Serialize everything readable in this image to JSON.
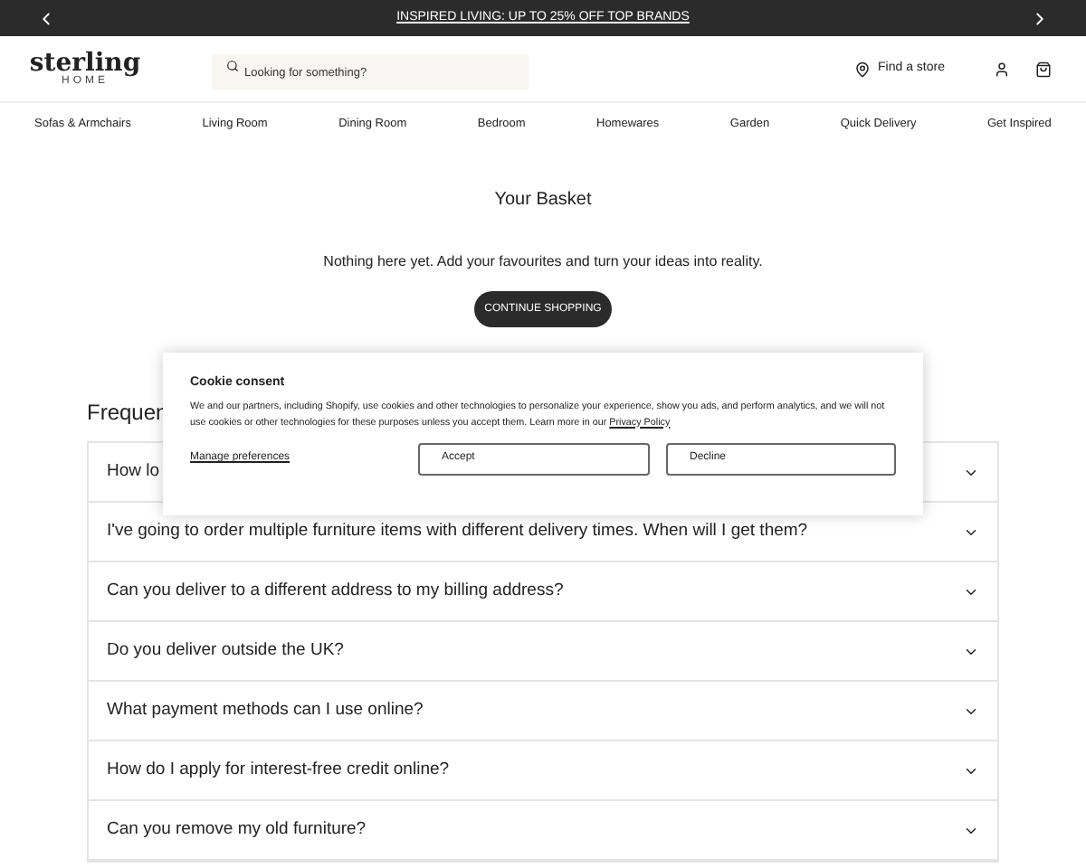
{
  "promo_bar": {
    "text": "INSPIRED LIVING: UP TO 25% OFF TOP BRANDS"
  },
  "header": {
    "logo": "sterling",
    "logo_sub": "HOME",
    "search": {
      "placeholder": "Looking for something?"
    },
    "find_store": "Find a store"
  },
  "nav": [
    "Sofas & Armchairs",
    "Living Room",
    "Dining Room",
    "Bedroom",
    "Homewares",
    "Garden",
    "Quick Delivery",
    "Get Inspired"
  ],
  "basket": {
    "title": "Your Basket",
    "message": "Nothing here yet. Add your favourites and turn your ideas into reality.",
    "button": "CONTINUE SHOPPING"
  },
  "faq": {
    "heading": "Frequen",
    "items": [
      {
        "question": "How lo",
        "expanded": false
      },
      {
        "question": "I've going to order multiple furniture items with different delivery times. When will I get them?",
        "expanded": false
      },
      {
        "question": "Can you deliver to a different address to my billing address?",
        "expanded": false
      },
      {
        "question": "Do you deliver outside the UK?",
        "expanded": false
      },
      {
        "question": "What payment methods can I use online?",
        "expanded": false
      },
      {
        "question": "How do I apply for interest-free credit online?",
        "expanded": false
      },
      {
        "question": "Can you remove my old furniture?",
        "expanded": false
      }
    ]
  },
  "cookie_consent": {
    "title": "Cookie consent",
    "text": "We and our partners, including Shopify, use cookies and other technologies to personalize your experience, show you ads, and perform analytics, and we will not use cookies or other technologies for these purposes unless you accept them. Learn more in our",
    "link": "Privacy Policy",
    "manage": "Manage preferences",
    "accept": "Accept",
    "decline": "Decline"
  }
}
